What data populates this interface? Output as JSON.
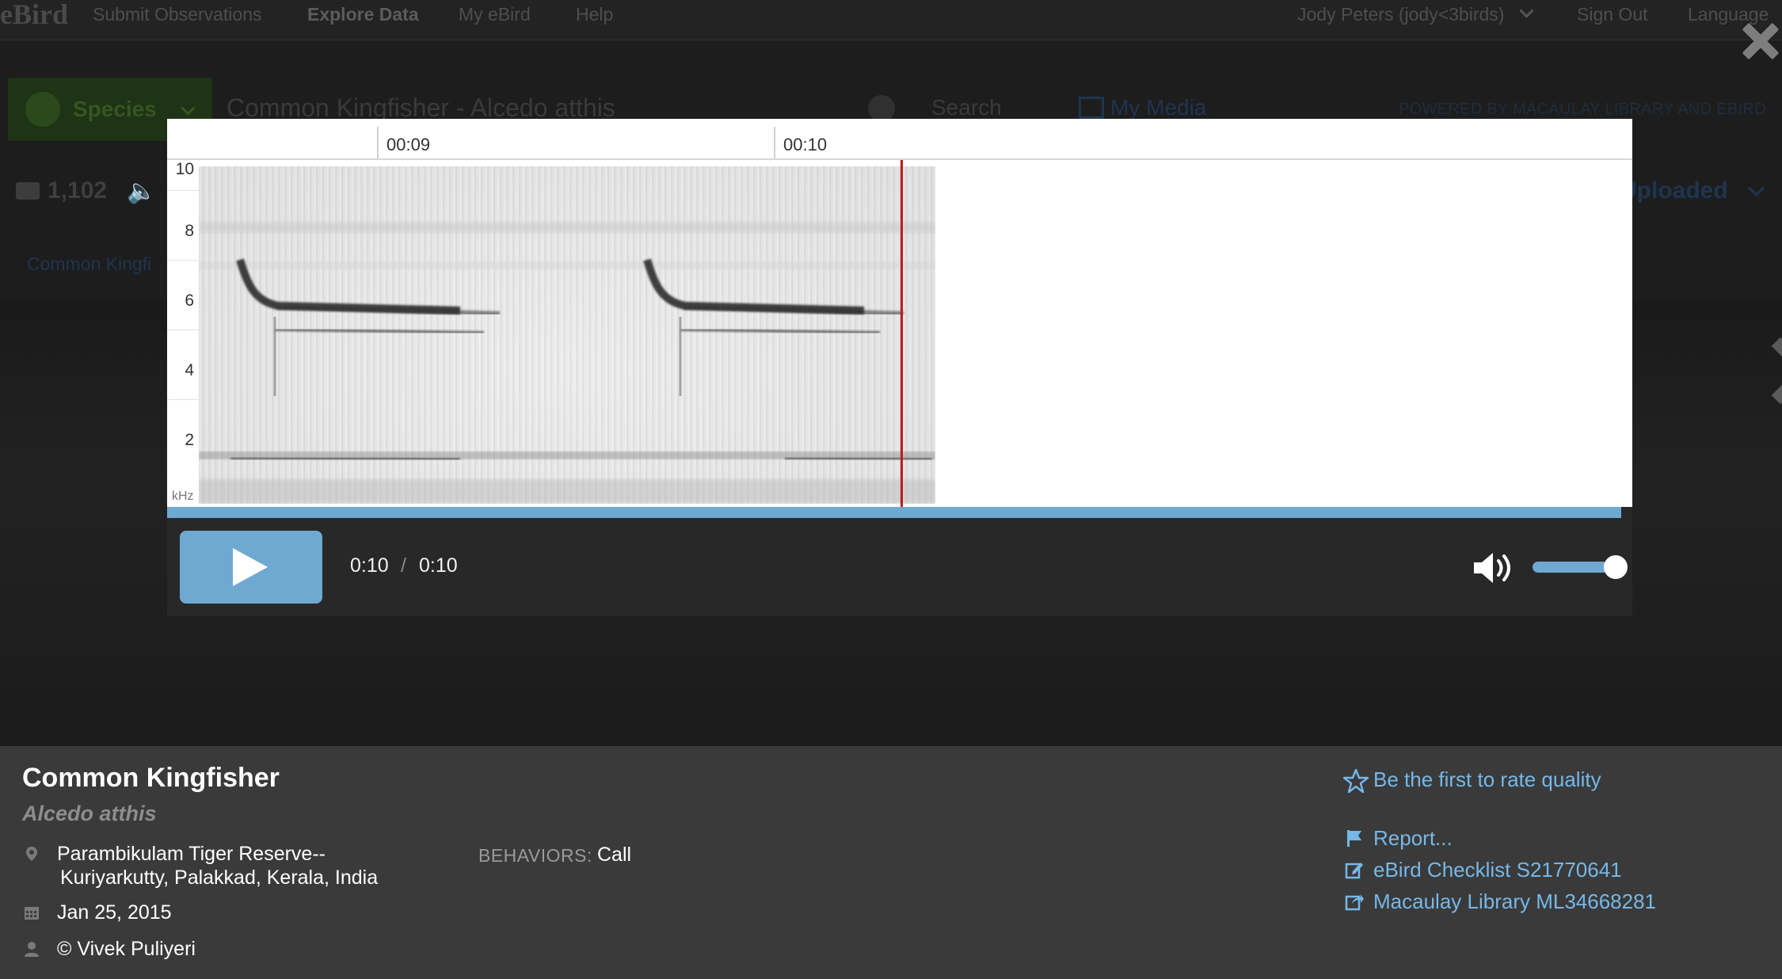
{
  "nav": {
    "logo": "eBird",
    "items": [
      "Submit Observations",
      "Explore Data",
      "My eBird",
      "Help"
    ],
    "user": "Jody Peters (jody<3birds)",
    "sign_out": "Sign Out",
    "language": "Language"
  },
  "search": {
    "species_label": "Species",
    "query": "Common Kingfisher - Alcedo atthis",
    "search_label": "Search",
    "my_media": "My Media",
    "powered_by": "POWERED BY MACAULAY LIBRARY AND EBIRD"
  },
  "results": {
    "photo_count": "1,102",
    "sort": "y Uploaded",
    "breadcrumb": "Common Kingfi"
  },
  "player": {
    "time_labels": [
      "00:09",
      "00:10"
    ],
    "y_labels": [
      "10",
      "8",
      "6",
      "4",
      "2"
    ],
    "y_unit": "kHz",
    "current_time": "0:10",
    "separator": "/",
    "duration": "0:10",
    "progress_fraction": 1.0,
    "volume_fraction": 1.0,
    "accent_color": "#6ea9d1",
    "playhead_color": "#c21a1a",
    "icons": {
      "play": "play-icon",
      "volume": "volume-icon"
    }
  },
  "info": {
    "common_name": "Common Kingfisher",
    "scientific_name": "Alcedo atthis",
    "location_line1": "Parambikulam Tiger Reserve--",
    "location_line2": "Kuriyarkutty, Palakkad, Kerala, India",
    "date": "Jan 25, 2015",
    "credit": "© Vivek Puliyeri",
    "behaviors_label": "BEHAVIORS:",
    "behaviors_value": "Call",
    "rate_quality": "Be the first to rate quality",
    "report": "Report...",
    "checklist": "eBird Checklist S21770641",
    "macaulay": "Macaulay Library ML34668281",
    "link_color": "#76b8e8"
  }
}
